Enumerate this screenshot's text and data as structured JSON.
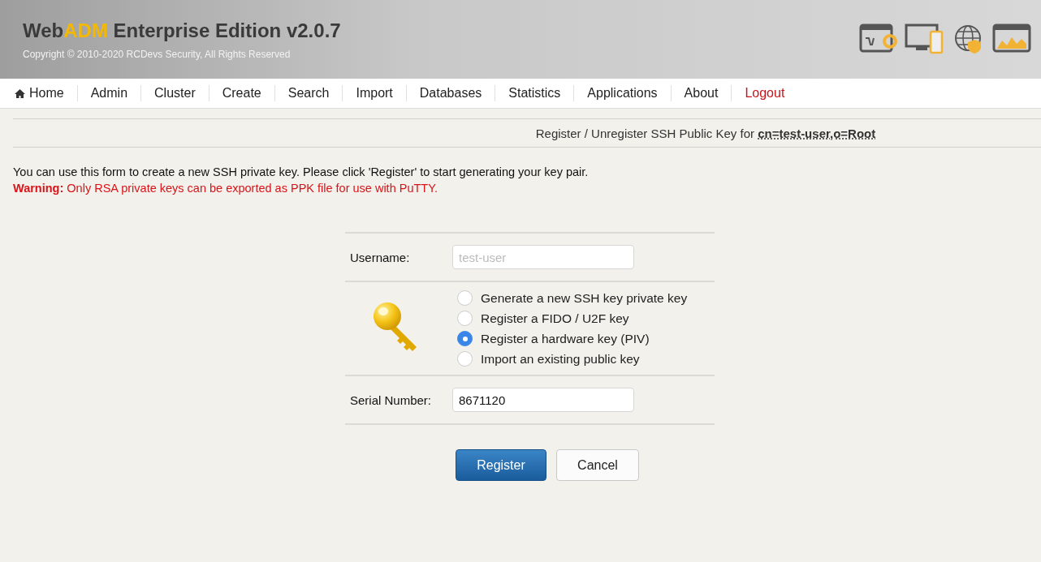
{
  "header": {
    "brand": {
      "prefix": "Web",
      "accent": "ADM",
      "rest": " Enterprise Edition v2.0.7"
    },
    "copyright": "Copyright © 2010-2020 RCDevs Security, All Rights Reserved"
  },
  "nav": [
    {
      "label": "Home",
      "kind": "home"
    },
    {
      "label": "Admin",
      "kind": "link"
    },
    {
      "label": "Cluster",
      "kind": "link"
    },
    {
      "label": "Create",
      "kind": "link"
    },
    {
      "label": "Search",
      "kind": "link"
    },
    {
      "label": "Import",
      "kind": "link"
    },
    {
      "label": "Databases",
      "kind": "link"
    },
    {
      "label": "Statistics",
      "kind": "link"
    },
    {
      "label": "Applications",
      "kind": "link"
    },
    {
      "label": "About",
      "kind": "link"
    },
    {
      "label": "Logout",
      "kind": "logout"
    }
  ],
  "page_title": "Register / Unregister SSH Public Key for **cn=test-user,o=Root**",
  "intro": "You can use this form to create a new SSH private key. Please click 'Register' to start generating your key pair.",
  "warning": "**Warning:** Only RSA private keys can be exported as PPK file for use with PuTTY.",
  "form": {
    "username": {
      "label": "Username:",
      "value": "test-user",
      "disabled": true
    },
    "options": [
      {
        "label": "Generate a new SSH key private key",
        "selected": false
      },
      {
        "label": "Register a FIDO / U2F key",
        "selected": false
      },
      {
        "label": "Register a hardware key (PIV)",
        "selected": true
      },
      {
        "label": "Import an existing public key",
        "selected": false
      }
    ],
    "serial": {
      "label": "Serial Number:",
      "value": "8671120",
      "disabled": false
    }
  },
  "buttons": [
    {
      "label": "Register",
      "kind": "primary"
    },
    {
      "label": "Cancel",
      "kind": "secondary"
    }
  ]
}
